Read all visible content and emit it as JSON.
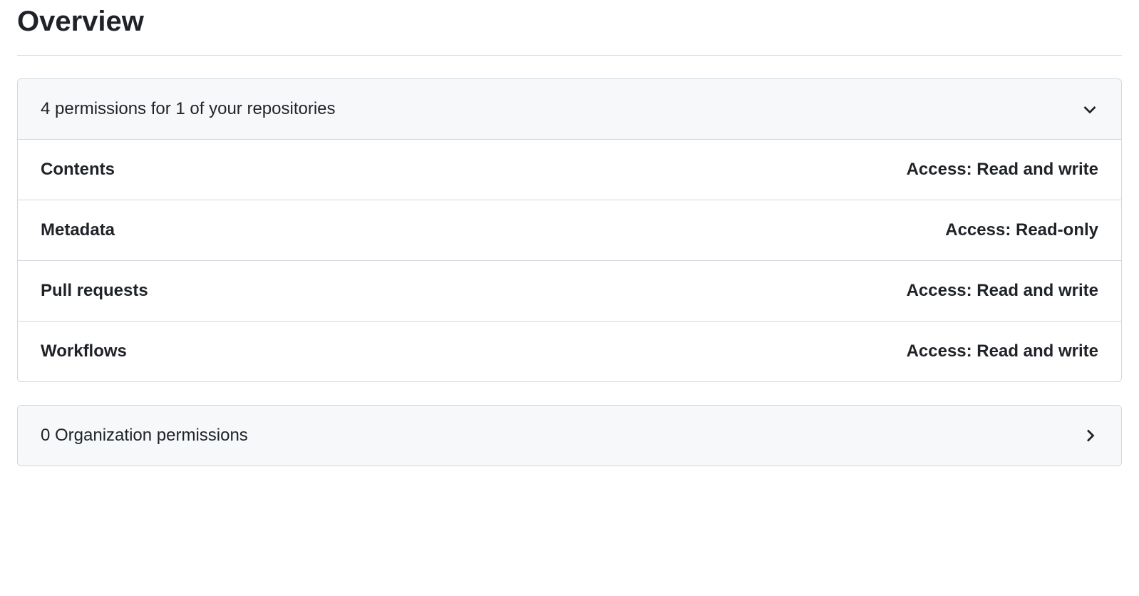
{
  "title": "Overview",
  "repo_permissions": {
    "header": "4 permissions for 1 of your repositories",
    "items": [
      {
        "name": "Contents",
        "access": "Access: Read and write"
      },
      {
        "name": "Metadata",
        "access": "Access: Read-only"
      },
      {
        "name": "Pull requests",
        "access": "Access: Read and write"
      },
      {
        "name": "Workflows",
        "access": "Access: Read and write"
      }
    ]
  },
  "org_permissions": {
    "header": "0 Organization permissions"
  }
}
